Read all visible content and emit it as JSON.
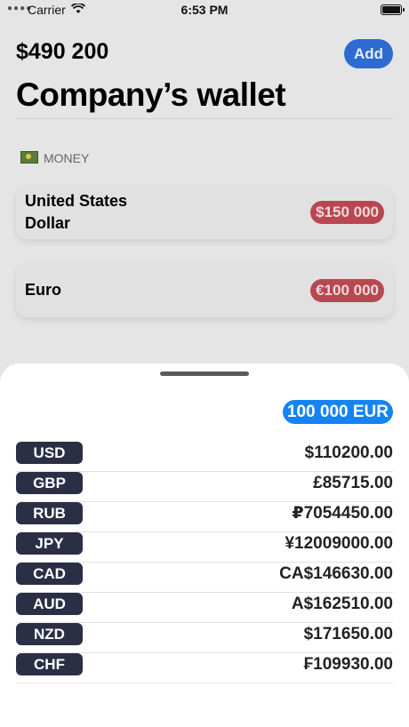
{
  "status_bar": {
    "carrier": "Carrier",
    "time": "6:53 PM"
  },
  "header": {
    "balance": "$490 200",
    "add_label": "Add",
    "title": "Company’s wallet"
  },
  "section": {
    "icon": "banknote-icon",
    "label": "MONEY"
  },
  "cards": [
    {
      "name": "United States Dollar",
      "amount": "$150 000"
    },
    {
      "name": "Euro",
      "amount": "€100 000"
    }
  ],
  "sheet": {
    "base_amount": "100 000 EUR",
    "rates": [
      {
        "code": "USD",
        "value": "$110200.00"
      },
      {
        "code": "GBP",
        "value": "£85715.00"
      },
      {
        "code": "RUB",
        "value": "₽7054450.00"
      },
      {
        "code": "JPY",
        "value": "¥12009000.00"
      },
      {
        "code": "CAD",
        "value": "CA$146630.00"
      },
      {
        "code": "AUD",
        "value": "A$162510.00"
      },
      {
        "code": "NZD",
        "value": "$171650.00"
      },
      {
        "code": "CHF",
        "value": "₣109930.00"
      }
    ]
  },
  "colors": {
    "accent": "#2e6bd1",
    "amount_badge": "#b94752",
    "code_pill": "#2b2f45",
    "sheet_badge": "#1583f2"
  }
}
